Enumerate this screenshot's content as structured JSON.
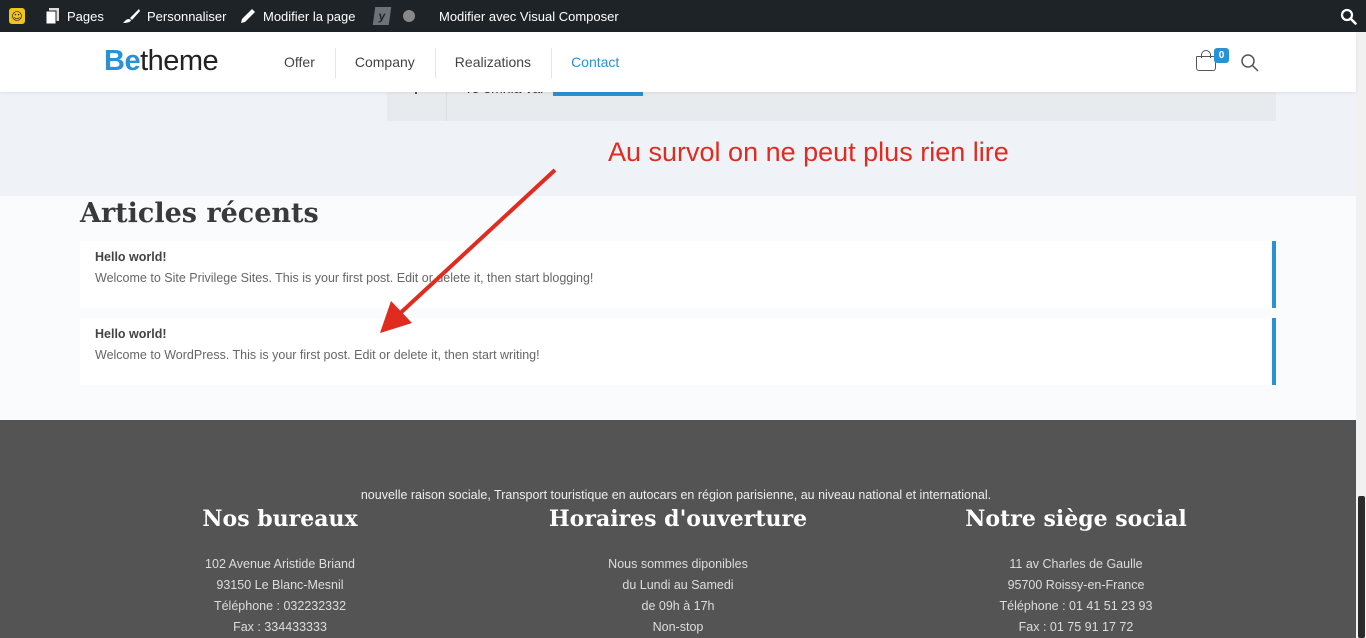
{
  "adminbar": {
    "items": [
      {
        "label": "Pages",
        "icon": "pages-icon"
      },
      {
        "label": "Personnaliser",
        "icon": "brush-icon"
      },
      {
        "label": "Modifier la page",
        "icon": "pencil-icon"
      },
      {
        "label": "Modifier avec Visual Composer",
        "icon": "visual-composer"
      }
    ],
    "logo_glyph": "☺",
    "yoast_glyph": "y"
  },
  "header": {
    "logo_be": "Be",
    "logo_theme": "theme",
    "nav": [
      {
        "label": "Offer",
        "active": false
      },
      {
        "label": "Company",
        "active": false
      },
      {
        "label": "Realizations",
        "active": false
      },
      {
        "label": "Contact",
        "active": true
      }
    ],
    "cart_count": "0"
  },
  "upper": {
    "partial_text": "re omnia var"
  },
  "annotation": {
    "text": "Au survol on ne peut plus rien lire",
    "color": "#e02b20"
  },
  "articles": {
    "title": "Articles récents",
    "posts": [
      {
        "title": "Hello world!",
        "excerpt": "Welcome to Site Privilege Sites. This is your first post. Edit or delete it, then start blogging!"
      },
      {
        "title": "Hello world!",
        "excerpt": "Welcome to WordPress. This is your first post. Edit or delete it, then start writing!"
      }
    ]
  },
  "footer": {
    "tagline": "nouvelle raison sociale, Transport touristique en autocars en région parisienne, au niveau national et international.",
    "columns": [
      {
        "heading": "Nos bureaux",
        "lines": [
          "102 Avenue Aristide Briand",
          "93150 Le Blanc-Mesnil",
          "Téléphone : 032232332",
          "Fax : 334433333"
        ]
      },
      {
        "heading": "Horaires d'ouverture",
        "lines": [
          "Nous sommes diponibles",
          "du Lundi au Samedi",
          "de 09h à 17h",
          "Non-stop"
        ]
      },
      {
        "heading": "Notre siège social",
        "lines": [
          "11 av Charles de Gaulle",
          "95700 Roissy-en-France",
          "Téléphone : 01 41 51 23 93",
          "Fax : 01 75 91 17 72"
        ]
      }
    ]
  },
  "colors": {
    "accent": "#2991d6",
    "adminbar": "#1d2327",
    "footer": "#545454"
  }
}
